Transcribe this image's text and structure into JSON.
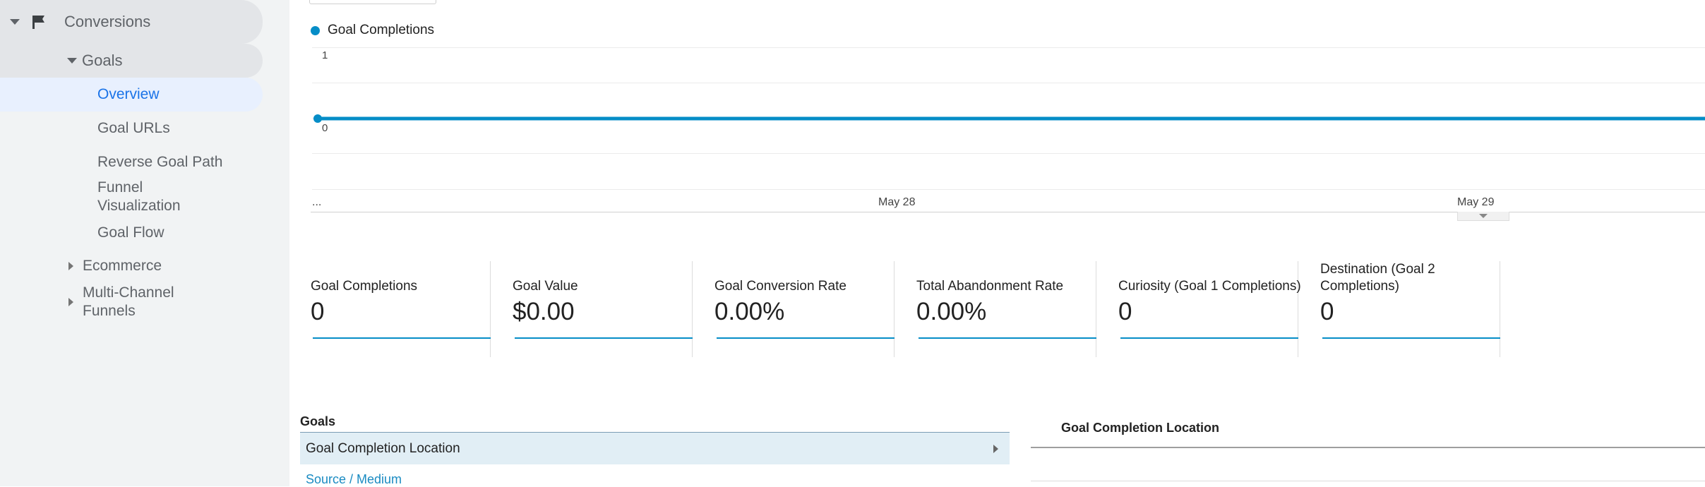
{
  "sidebar": {
    "conversions_label": "Conversions",
    "goals_label": "Goals",
    "goal_items": [
      "Overview",
      "Goal URLs",
      "Reverse Goal Path",
      "Funnel Visualization",
      "Goal Flow"
    ],
    "ecommerce_label": "Ecommerce",
    "multichannel_label": "Multi-Channel Funnels",
    "active_item": "Overview",
    "icon": "flag-icon"
  },
  "chart": {
    "legend_label": "Goal Completions",
    "y_ticks": [
      "1",
      "0"
    ],
    "x_leading": "...",
    "x_ticks": [
      "May 28",
      "May 29"
    ],
    "line_color": "#058dc7"
  },
  "chart_data": {
    "type": "line",
    "series": [
      {
        "name": "Goal Completions",
        "values": [
          0,
          0,
          0
        ]
      }
    ],
    "x": [
      "...",
      "May 28",
      "May 29"
    ],
    "ylim": [
      0,
      1
    ]
  },
  "metrics": [
    {
      "name": "Goal Completions",
      "value": "0"
    },
    {
      "name": "Goal Value",
      "value": "$0.00"
    },
    {
      "name": "Goal Conversion Rate",
      "value": "0.00%"
    },
    {
      "name": "Total Abandonment Rate",
      "value": "0.00%"
    },
    {
      "name": "Curiosity (Goal 1 Completions)",
      "value": "0"
    },
    {
      "name": "Destination (Goal 2 Completions)",
      "value": "0"
    }
  ],
  "goals_table": {
    "header": "Goals",
    "selected_row": "Goal Completion Location",
    "link_row": "Source / Medium"
  },
  "right_panel": {
    "title": "Goal Completion Location"
  }
}
